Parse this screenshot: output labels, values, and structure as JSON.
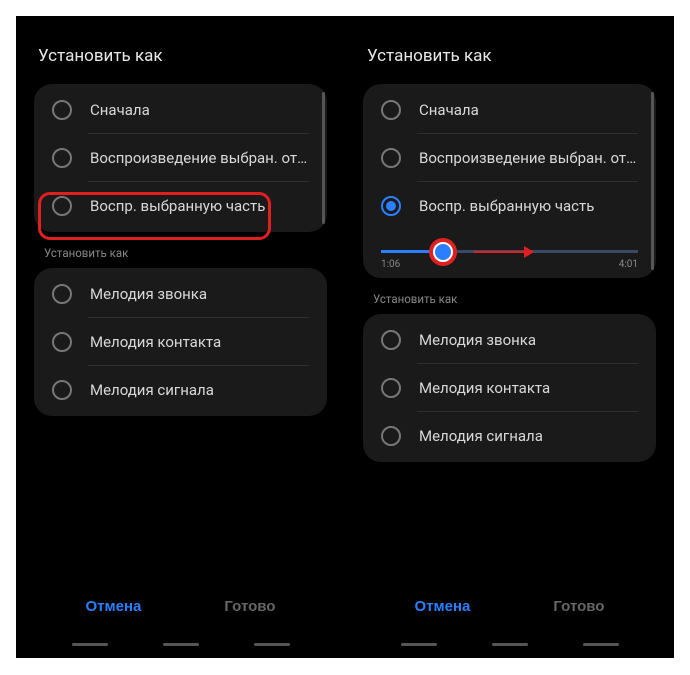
{
  "title": "Установить как",
  "play_options": {
    "from_start": "Сначала",
    "play_selected_excerpt": "Воспроизведение выбран. отры..",
    "play_selected_part": "Воспр. выбранную часть"
  },
  "slider": {
    "start": "1:06",
    "end": "4:01"
  },
  "set_as_header": "Установить как",
  "set_as": {
    "ringtone": "Мелодия звонка",
    "contact": "Мелодия контакта",
    "notification": "Мелодия сигнала"
  },
  "buttons": {
    "cancel": "Отмена",
    "done": "Готово"
  }
}
